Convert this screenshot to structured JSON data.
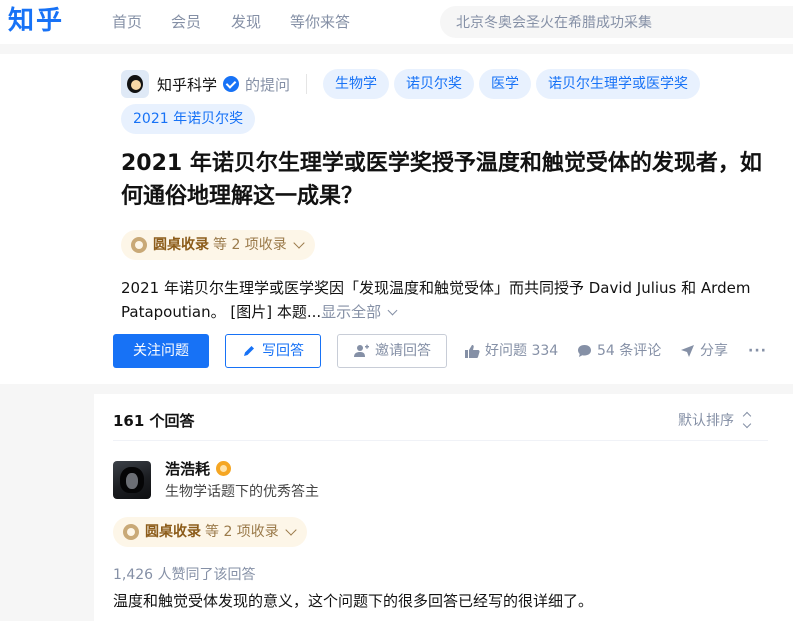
{
  "header": {
    "logo": "知乎",
    "nav": [
      "首页",
      "会员",
      "发现",
      "等你来答"
    ],
    "search_placeholder": "北京冬奥会圣火在希腊成功采集"
  },
  "question": {
    "author": "知乎科学",
    "asked_label": "的提问",
    "tags": [
      "生物学",
      "诺贝尔奖",
      "医学",
      "诺贝尔生理学或医学奖",
      "2021 年诺贝尔奖"
    ],
    "title": "2021 年诺贝尔生理学或医学奖授予温度和触觉受体的发现者，如何通俗地理解这一成果？",
    "collection": {
      "name": "圆桌收录",
      "suffix": "等 2 项收录"
    },
    "excerpt": "2021 年诺贝尔生理学或医学奖因「发现温度和触觉受体」而共同授予 David Julius 和 Ardem Patapoutian。 [图片] 本题...",
    "show_all": "显示全部",
    "actions": {
      "follow": "关注问题",
      "write": "写回答",
      "invite": "邀请回答",
      "upvote": "好问题 334",
      "comments": "54 条评论",
      "share": "分享",
      "more": "···"
    }
  },
  "answers": {
    "count_label": "161 个回答",
    "sort_label": "默认排序",
    "first": {
      "author": "浩浩耗",
      "bio": "生物学话题下的优秀答主",
      "collection": {
        "name": "圆桌收录",
        "suffix": "等 2 项收录"
      },
      "agree": "1,426 人赞同了该回答",
      "text": "温度和触觉受体发现的意义，这个问题下的很多回答已经写的很详细了。"
    }
  },
  "colors": {
    "brand": "#1772f6",
    "muted": "#8590a6",
    "tag_bg": "#e8f1fe",
    "collect_bg": "#fdf6e8"
  }
}
